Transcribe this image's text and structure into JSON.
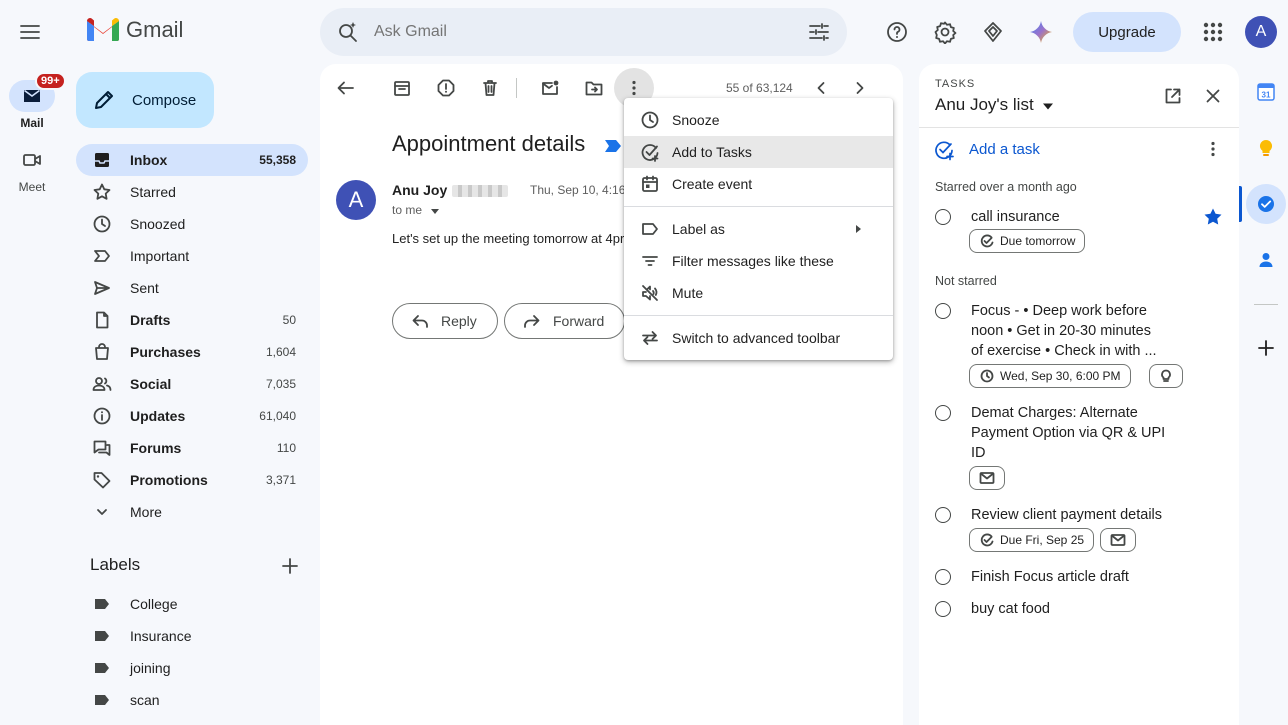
{
  "app": {
    "brand": "Gmail",
    "search_placeholder": "Ask Gmail",
    "upgrade_label": "Upgrade",
    "account_initial": "A"
  },
  "rail": {
    "mail_label": "Mail",
    "mail_badge": "99+",
    "meet_label": "Meet"
  },
  "compose_label": "Compose",
  "nav": [
    {
      "label": "Inbox",
      "count": "55,358",
      "icon": "inbox-icon"
    },
    {
      "label": "Starred",
      "count": "",
      "icon": "star-icon"
    },
    {
      "label": "Snoozed",
      "count": "",
      "icon": "clock-icon"
    },
    {
      "label": "Important",
      "count": "",
      "icon": "important-icon"
    },
    {
      "label": "Sent",
      "count": "",
      "icon": "send-icon"
    },
    {
      "label": "Drafts",
      "count": "50",
      "icon": "draft-icon"
    },
    {
      "label": "Purchases",
      "count": "1,604",
      "icon": "bag-icon"
    },
    {
      "label": "Social",
      "count": "7,035",
      "icon": "people-icon"
    },
    {
      "label": "Updates",
      "count": "61,040",
      "icon": "info-icon"
    },
    {
      "label": "Forums",
      "count": "110",
      "icon": "forum-icon"
    },
    {
      "label": "Promotions",
      "count": "3,371",
      "icon": "tag-icon"
    },
    {
      "label": "More",
      "count": "",
      "icon": "chevron-down-icon"
    }
  ],
  "labels_heading": "Labels",
  "labels": [
    "College",
    "Insurance",
    "joining",
    "scan"
  ],
  "email": {
    "pager": "55 of 63,124",
    "subject": "Appointment details",
    "sender": "Anu Joy",
    "sender_initial": "A",
    "date": "Thu, Sep 10, 4:16",
    "to": "to me",
    "body": "Let's set up the meeting tomorrow at 4pr",
    "reply_label": "Reply",
    "forward_label": "Forward"
  },
  "menu": [
    {
      "label": "Snooze",
      "icon": "clock-icon"
    },
    {
      "label": "Add to Tasks",
      "icon": "add-task-icon"
    },
    {
      "label": "Create event",
      "icon": "calendar-add-icon"
    },
    {
      "label": "Label as",
      "icon": "label-icon"
    },
    {
      "label": "Filter messages like these",
      "icon": "filter-icon"
    },
    {
      "label": "Mute",
      "icon": "mute-icon"
    },
    {
      "label": "Switch to advanced toolbar",
      "icon": "swap-icon"
    }
  ],
  "tasks": {
    "eyebrow": "TASKS",
    "list_name": "Anu Joy's list",
    "add_label": "Add a task",
    "starred_section": "Starred over a month ago",
    "not_starred_section": "Not starred",
    "items": [
      {
        "title": "call insurance",
        "chip": "Due tomorrow"
      },
      {
        "title": "Focus - • Deep work before noon • Get in 20-30 minutes of exercise  • Check in with ...",
        "chip": "Wed, Sep 30, 6:00 PM"
      },
      {
        "title": "Demat Charges: Alternate Payment Option via QR & UPI ID",
        "chip": ""
      },
      {
        "title": "Review client payment details",
        "chip": "Due Fri, Sep 25"
      },
      {
        "title": "Finish Focus article draft",
        "chip": ""
      },
      {
        "title": "buy cat food",
        "chip": ""
      }
    ]
  },
  "colors": {
    "accent_blue": "#0b57d0",
    "selected_bg": "#d3e3fd",
    "compose_bg": "#c2e7ff",
    "avatar": "#3f51b5",
    "badge_red": "#c5221f"
  }
}
